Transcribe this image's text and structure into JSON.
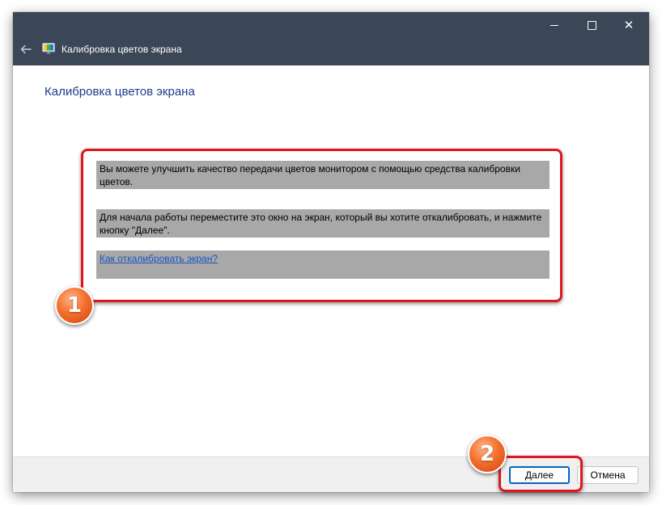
{
  "window": {
    "title": "Калибровка цветов экрана",
    "icons": {
      "back": "back-arrow-icon",
      "app": "monitor-icon",
      "minimize": "minimize-icon",
      "maximize": "maximize-icon",
      "close": "close-icon"
    }
  },
  "main": {
    "heading": "Калибровка цветов экрана",
    "paragraph1": "Вы можете улучшить качество передачи цветов монитором с помощью средства калибровки цветов.",
    "paragraph2": "Для начала работы переместите это окно на экран, который вы хотите откалибровать, и нажмите кнопку \"Далее\".",
    "help_link": "Как откалибровать экран?"
  },
  "footer": {
    "next_label": "Далее",
    "cancel_label": "Отмена"
  },
  "annotations": {
    "badge1": "1",
    "badge2": "2"
  },
  "colors": {
    "titlebar": "#3b4657",
    "heading": "#1e3a8a",
    "link": "#1a56c4",
    "text_highlight": "#a8a8a8",
    "annotation_outline": "#e0161f",
    "annotation_badge": "#f3712e",
    "default_button_border": "#0067c0"
  }
}
